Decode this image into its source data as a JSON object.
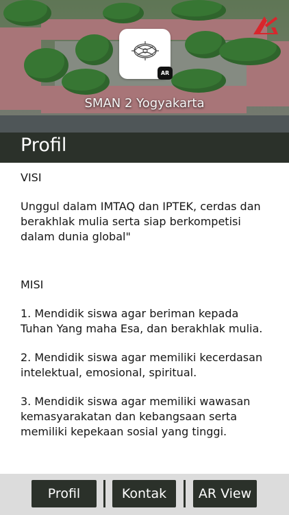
{
  "header": {
    "school_name": "SMAN 2 Yogyakarta",
    "logo_badge": "AR"
  },
  "page": {
    "title": "Profil"
  },
  "content": {
    "visi_heading": "VISI",
    "visi_text": "Unggul dalam IMTAQ dan IPTEK, cerdas dan berakhlak mulia serta siap berkompetisi dalam dunia global\"",
    "misi_heading": "MISI",
    "misi_items": [
      "1. Mendidik siswa agar beriman kepada Tuhan Yang maha Esa, dan berakhlak mulia.",
      "2. Mendidik siswa agar memiliki kecerdasan intelektual, emosional, spiritual.",
      "3. Mendidik siswa agar memiliki wawasan kemasyarakatan dan kebangsaan serta memiliki kepekaan sosial yang tinggi."
    ]
  },
  "nav": {
    "profil": "Profil",
    "kontak": "Kontak",
    "ar_view": "AR View"
  },
  "colors": {
    "bar": "#2b312a",
    "nav_bg": "#dcdcdc",
    "roof": "#c9898e",
    "brand_red": "#d9262c"
  }
}
